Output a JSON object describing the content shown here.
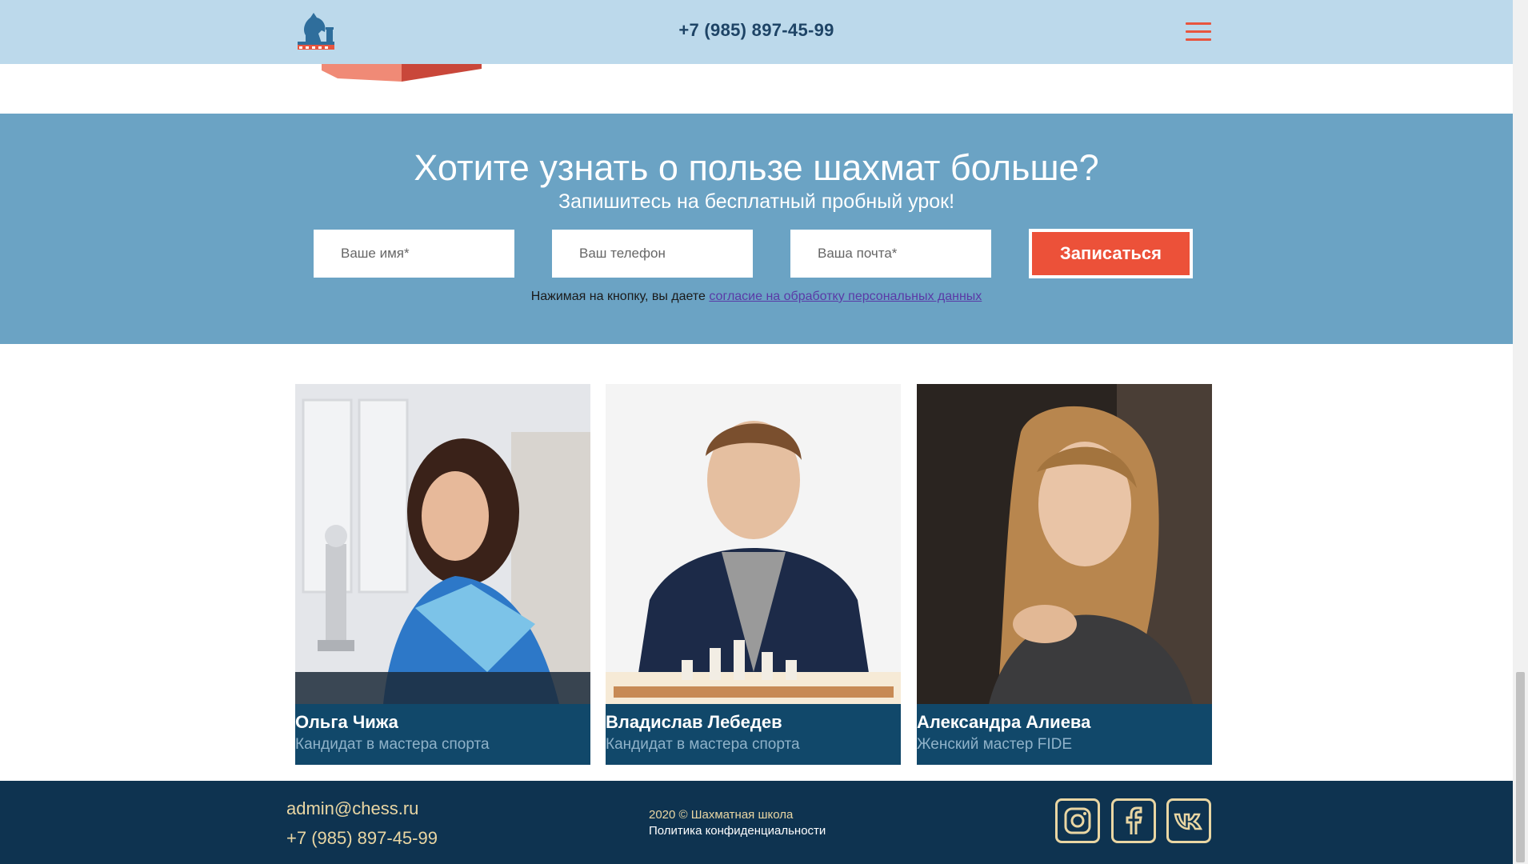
{
  "header": {
    "phone": "+7 (985) 897-45-99",
    "logo_icon": "chess-knight-logo",
    "menu_icon": "hamburger-icon",
    "accent_color": "#e8553e"
  },
  "signup": {
    "title": "Хотите узнать о пользе шахмат больше?",
    "subtitle": "Запишитесь на бесплатный пробный урок!",
    "name_placeholder": "Ваше имя*",
    "phone_placeholder": "Ваш телефон",
    "email_placeholder": "Ваша почта*",
    "submit_label": "Записаться",
    "consent_text": "Нажимая на кнопку, вы даете ",
    "consent_link": "согласие на обработку персональных данных",
    "background_color": "#6ba3c4"
  },
  "coaches": [
    {
      "name": "Ольга Чижа",
      "title": "Кандидат в мастера спорта"
    },
    {
      "name": "Владислав Лебедев",
      "title": "Кандидат в мастера спорта"
    },
    {
      "name": "Александра Алиева",
      "title": "Женский мастер FIDE"
    }
  ],
  "footer": {
    "email": "admin@chess.ru",
    "phone": "+7 (985) 897-45-99",
    "copyright": "2020 © Шахматная школа",
    "policy": "Политика конфиденциальности",
    "social": [
      "instagram-icon",
      "facebook-icon",
      "vk-icon"
    ],
    "accent_color": "#e9d6a3"
  }
}
